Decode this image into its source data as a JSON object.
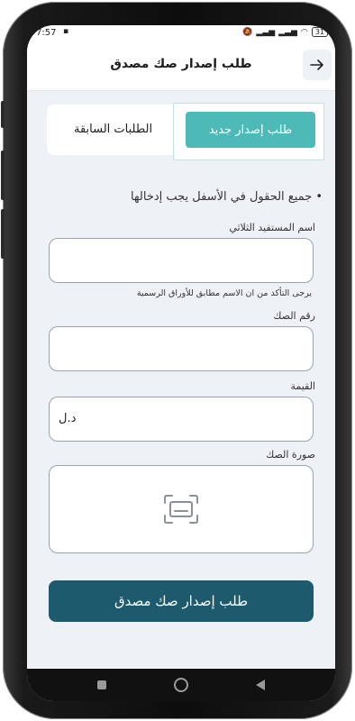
{
  "status": {
    "time": "7:57",
    "battery": "31"
  },
  "header": {
    "title": "طلب إصدار صك مصدق"
  },
  "tabs": {
    "new_request": "طلب إصدار جديد",
    "previous_requests": "الطلبات السابقة"
  },
  "form": {
    "note": "• جميع الحقول في الأسفل يجب إدخالها",
    "beneficiary_label": "اسم المستفيد الثلاثي",
    "beneficiary_value": "",
    "beneficiary_helper": "يرجى التأكد من ان الاسم مطابق  للأوراق الرسمية",
    "check_number_label": "رقم الصك",
    "check_number_value": "",
    "amount_label": "القيمة",
    "amount_currency": "د.ل",
    "image_label": "صورة الصك"
  },
  "actions": {
    "submit_label": "طلب إصدار صك مصدق"
  },
  "colors": {
    "accent": "#4dbab8",
    "primary_button": "#1d5a6e"
  },
  "icons": {
    "back": "arrow-right-icon",
    "upload": "scan-card-icon"
  }
}
